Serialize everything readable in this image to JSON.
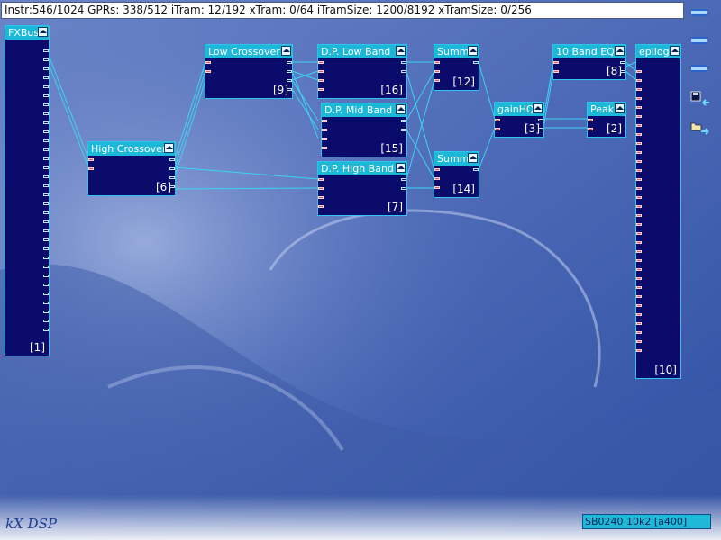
{
  "status": {
    "text": "Instr:546/1024 GPRs: 338/512 iTram: 12/192 xTram: 0/64 iTramSize: 1200/8192 xTramSize: 0/256"
  },
  "modules": [
    {
      "key": "fxbus",
      "title": "FXBus",
      "index": "[1]"
    },
    {
      "key": "high-crossover",
      "title": "High Crossover",
      "index": "[6]"
    },
    {
      "key": "low-crossover",
      "title": "Low Crossover",
      "index": "[9]"
    },
    {
      "key": "dp-low-band",
      "title": "D.P. Low Band",
      "index": "[16]"
    },
    {
      "key": "dp-mid-band",
      "title": "D.P. Mid Band",
      "index": "[15]"
    },
    {
      "key": "dp-high-band",
      "title": "D.P. High Band",
      "index": "[7]"
    },
    {
      "key": "summ-upper",
      "title": "Summ",
      "index": "[12]"
    },
    {
      "key": "summ-lower",
      "title": "Summ",
      "index": "[14]"
    },
    {
      "key": "gainhq",
      "title": "gainHQ",
      "index": "[3]"
    },
    {
      "key": "10-band-eq",
      "title": "10 Band EQ",
      "index": "[8]"
    },
    {
      "key": "peak",
      "title": "Peak",
      "index": "[2]"
    },
    {
      "key": "epilog",
      "title": "epilog",
      "index": "[10]"
    }
  ],
  "footer": {
    "brand": "kX DSP",
    "device": "SB0240 10k2 [a400]"
  },
  "colors": {
    "module_bg": "#0a0b6a",
    "title_bg": "#1cb8d8",
    "wire": "#3cd4f4",
    "background": "#4e6bb6"
  },
  "icons": [
    "menu-icon",
    "save-icon",
    "load-icon",
    "collapse-icon"
  ]
}
